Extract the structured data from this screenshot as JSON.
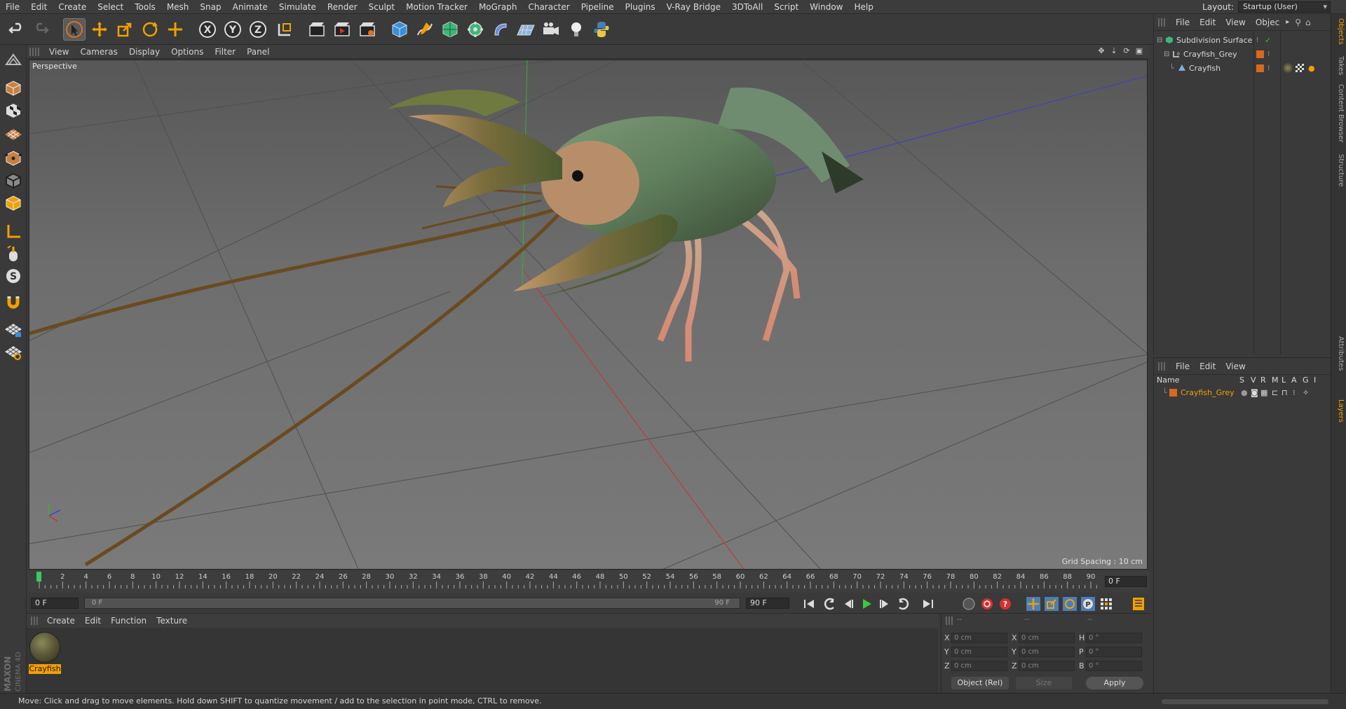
{
  "menubar": {
    "items": [
      "File",
      "Edit",
      "Create",
      "Select",
      "Tools",
      "Mesh",
      "Snap",
      "Animate",
      "Simulate",
      "Render",
      "Sculpt",
      "Motion Tracker",
      "MoGraph",
      "Character",
      "Pipeline",
      "Plugins",
      "V-Ray Bridge",
      "3DToAll",
      "Script",
      "Window",
      "Help"
    ],
    "layout_label": "Layout:",
    "layout_value": "Startup (User)"
  },
  "viewport": {
    "menu": [
      "View",
      "Cameras",
      "Display",
      "Options",
      "Filter",
      "Panel"
    ],
    "camera_label": "Perspective",
    "grid_spacing": "Grid Spacing : 10 cm"
  },
  "timeline": {
    "ticks": [
      "0",
      "2",
      "4",
      "6",
      "8",
      "10",
      "12",
      "14",
      "16",
      "18",
      "20",
      "22",
      "24",
      "26",
      "28",
      "30",
      "32",
      "34",
      "36",
      "38",
      "40",
      "42",
      "44",
      "46",
      "48",
      "50",
      "52",
      "54",
      "56",
      "58",
      "60",
      "62",
      "64",
      "66",
      "68",
      "70",
      "72",
      "74",
      "76",
      "78",
      "80",
      "82",
      "84",
      "86",
      "88",
      "90"
    ],
    "end_field": "0 F",
    "current_frame": "0 F",
    "range_start": "0 F",
    "range_end": "90 F",
    "max_frame": "90 F"
  },
  "material_panel": {
    "menu": [
      "Create",
      "Edit",
      "Function",
      "Texture"
    ],
    "material_name": "Crayfish"
  },
  "coordinates": {
    "header": [
      "--",
      "--",
      "--"
    ],
    "rows": [
      {
        "a": "X",
        "av": "0 cm",
        "b": "X",
        "bv": "0 cm",
        "c": "H",
        "cv": "0 °"
      },
      {
        "a": "Y",
        "av": "0 cm",
        "b": "Y",
        "bv": "0 cm",
        "c": "P",
        "cv": "0 °"
      },
      {
        "a": "Z",
        "av": "0 cm",
        "b": "Z",
        "bv": "0 cm",
        "c": "B",
        "cv": "0 °"
      }
    ],
    "mode": "Object (Rel)",
    "size_mode": "Size",
    "apply": "Apply"
  },
  "object_manager": {
    "menu": [
      "File",
      "Edit",
      "View",
      "Objec"
    ],
    "objects": [
      "Subdivision Surface",
      "Crayfish_Grey",
      "Crayfish"
    ]
  },
  "layer_manager": {
    "menu": [
      "File",
      "Edit",
      "View"
    ],
    "columns": [
      "Name",
      "S",
      "V",
      "R",
      "M",
      "L",
      "A",
      "G",
      "I"
    ],
    "layer_name": "Crayfish_Grey"
  },
  "right_tabs": [
    "Objects",
    "Takes",
    "Content Browser",
    "Structure",
    "Attributes",
    "Layers"
  ],
  "status": "Move: Click and drag to move elements. Hold down SHIFT to quantize movement / add to the selection in point mode, CTRL to remove.",
  "brand": {
    "maxon": "MAXON",
    "product": "CINEMA 4D"
  },
  "colors": {
    "accent": "#f2a000",
    "layer_orange": "#d8691d",
    "x_axis": "#c83232",
    "y_axis": "#32b432",
    "z_axis": "#3c3cd2"
  }
}
